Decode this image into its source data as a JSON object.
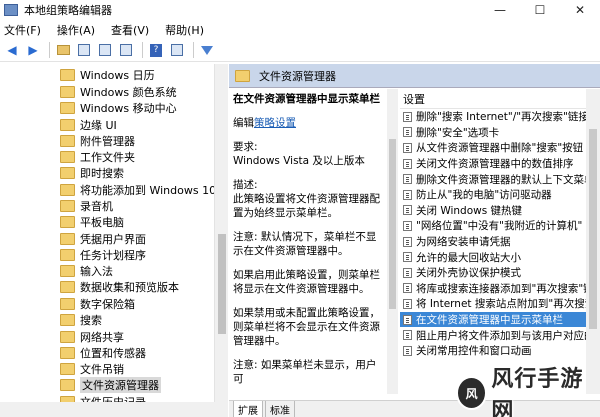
{
  "window": {
    "title": "本地组策略编辑器",
    "minimize": "—",
    "maximize": "☐",
    "close": "✕"
  },
  "menu": [
    "文件(F)",
    "操作(A)",
    "查看(V)",
    "帮助(H)"
  ],
  "toolbar_icons": [
    "back-arrow",
    "forward-arrow",
    "up-folder",
    "show-tree",
    "properties",
    "export",
    "help",
    "view",
    "filter"
  ],
  "tree": {
    "items": [
      "Windows 日历",
      "Windows 颜色系统",
      "Windows 移动中心",
      "边缘 UI",
      "附件管理器",
      "工作文件夹",
      "即时搜索",
      "将功能添加到 Windows 10",
      "录音机",
      "平板电脑",
      "凭据用户界面",
      "任务计划程序",
      "输入法",
      "数据收集和预览版本",
      "数字保险箱",
      "搜索",
      "网络共享",
      "位置和传感器",
      "文件吊销",
      "文件资源管理器",
      "文件历史记录"
    ],
    "selected_index": 19
  },
  "right": {
    "header": "文件资源管理器",
    "desc": {
      "title": "在文件资源管理器中显示菜单栏",
      "edit_prefix": "编辑",
      "edit_link": "策略设置",
      "req_label": "要求:",
      "req_value": "Windows Vista 及以上版本",
      "desc_label": "描述:",
      "desc_text": "此策略设置将文件资源管理器配置为始终显示菜单栏。",
      "note": "注意: 默认情况下，菜单栏不显示在文件资源管理器中。",
      "enabled": "如果启用此策略设置，则菜单栏将显示在文件资源管理器中。",
      "disabled": "如果禁用或未配置此策略设置，则菜单栏将不会显示在文件资源管理器中。",
      "note2": "注意: 如果菜单栏未显示，用户可"
    },
    "list_header": "设置",
    "rows": [
      "删除\"搜索 Internet\"/\"再次搜索\"链接",
      "删除\"安全\"选项卡",
      "从文件资源管理器中删除\"搜索\"按钮",
      "关闭文件资源管理器中的数值排序",
      "删除文件资源管理器的默认上下文菜单",
      "防止从\"我的电脑\"访问驱动器",
      "关闭 Windows 键热键",
      "\"网络位置\"中没有\"我附近的计算机\"",
      "为网络安装申请凭据",
      "允许的最大回收站大小",
      "关闭外壳协议保护模式",
      "将库或搜索连接器添加到\"再次搜索\"链接",
      "将 Internet 搜索站点附加到\"再次搜索\"链接",
      "在文件资源管理器中显示菜单栏",
      "阻止用户将文件添加到与该用户对应的\"",
      "关闭常用控件和窗口动画"
    ],
    "selected_row": 13,
    "tabs": [
      "扩展",
      "标准"
    ]
  },
  "watermark": {
    "logo": "风",
    "text": "风行手游网"
  }
}
